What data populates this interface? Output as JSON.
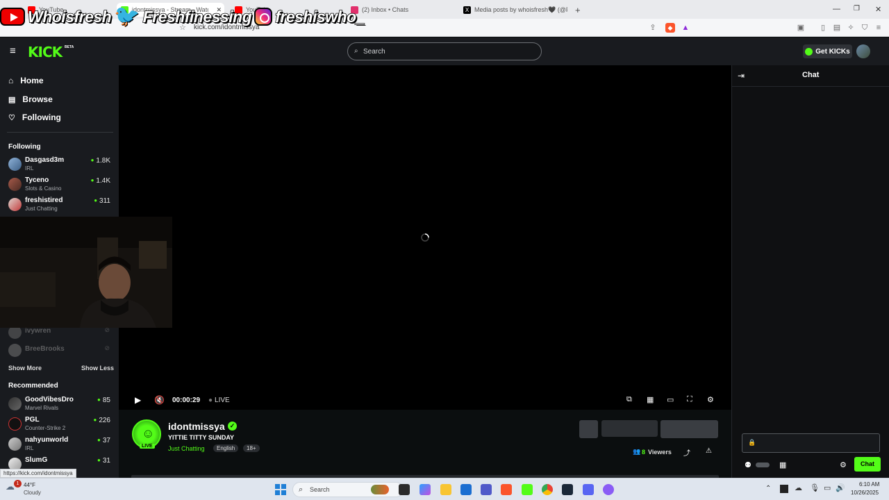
{
  "browser": {
    "tabs": [
      {
        "title": "YouTube",
        "color": "#ff0000"
      },
      {
        "title": "idontmissya - Stream - Watch Live on Kick",
        "color": "#53fc18"
      },
      {
        "title": "YouTube",
        "color": "#ff0000"
      },
      {
        "title": "(2) Inbox • Chats",
        "color": "#e1306c"
      },
      {
        "title": "Media posts by whoisfresh🖤 (@Fre...",
        "color": "#000000"
      }
    ],
    "url": "kick.com/idontmissya",
    "new_tab": "+",
    "status_url": "https://kick.com/idontmissya"
  },
  "overlay": {
    "youtube": "Whoisfresh",
    "twitter": "Freshfinessing",
    "instagram": "freshiswho_"
  },
  "kick": {
    "logo": "KICK",
    "logo_badge": "BETA",
    "search_placeholder": "Search",
    "get_kicks": "Get KICKs",
    "accent": "#53fc18"
  },
  "sidebar": {
    "nav": [
      {
        "label": "Home",
        "icon": "home-icon"
      },
      {
        "label": "Browse",
        "icon": "browse-icon"
      },
      {
        "label": "Following",
        "icon": "heart-icon"
      }
    ],
    "following_title": "Following",
    "following": [
      {
        "name": "Dasgasd3m",
        "category": "IRL",
        "viewers": "1.8K"
      },
      {
        "name": "Tyceno",
        "category": "Slots & Casino",
        "viewers": "1.4K"
      },
      {
        "name": "freshistired",
        "category": "Just Chatting",
        "viewers": "311"
      }
    ],
    "offline": [
      {
        "name": "ivywren"
      },
      {
        "name": "BreeBrooks"
      }
    ],
    "show_more": "Show More",
    "show_less": "Show Less",
    "recommended_title": "Recommended",
    "recommended": [
      {
        "name": "GoodVibesDro",
        "category": "Marvel Rivals",
        "viewers": "85"
      },
      {
        "name": "PGL",
        "category": "Counter-Strike 2",
        "viewers": "226"
      },
      {
        "name": "nahyunworld",
        "category": "IRL",
        "viewers": "37"
      },
      {
        "name": "SlumG",
        "category": "",
        "viewers": "31"
      }
    ]
  },
  "player": {
    "time": "00:00:29",
    "live": "LIVE"
  },
  "stream": {
    "channel": "idontmissya",
    "title": "YITTIE TITTY SUNDAY",
    "category": "Just Chatting",
    "tags": [
      "English",
      "18+"
    ],
    "live_badge": "LIVE",
    "viewers": "8",
    "viewers_label": "Viewers"
  },
  "chat": {
    "title": "Chat",
    "send": "Chat"
  },
  "taskbar": {
    "weather_temp": "44°F",
    "weather_desc": "Cloudy",
    "search": "Search",
    "time": "6:10 AM",
    "date": "10/26/2025",
    "notif": "1"
  }
}
